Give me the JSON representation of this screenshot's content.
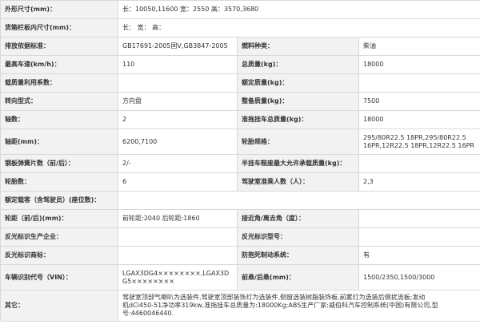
{
  "rows": [
    {
      "l1": "外形尺寸(mm)：",
      "v1": "长：10050,11600 宽：2550 高：3570,3680"
    },
    {
      "l1": "货箱栏板内尺寸(mm)：",
      "v1": "长： 宽： 高："
    },
    {
      "l1": "排放依据标准：",
      "v1": "GB17691-2005国Ⅴ,GB3847-2005",
      "l2": "燃料种类：",
      "v2": "柴油"
    },
    {
      "l1": "最高车速(km/h)：",
      "v1": "110",
      "l2": "总质量(kg)：",
      "v2": "18000"
    },
    {
      "l1": "载质量利用系数：",
      "v1": "",
      "l2": "额定质量(kg)：",
      "v2": ""
    },
    {
      "l1": "转向型式：",
      "v1": "方向盘",
      "l2": "整备质量(kg)：",
      "v2": "7500"
    },
    {
      "l1": "轴数：",
      "v1": "2",
      "l2": "准拖挂车总质量(kg)：",
      "v2": "18000"
    },
    {
      "l1": "轴距(mm)：",
      "v1": "6200,7100",
      "l2": "轮胎规格：",
      "v2a": "295/80R22.5 18PR,295/80R22.5",
      "v2b": "16PR,12R22.5 18PR,12R22.5 16PR"
    },
    {
      "l1": "钢板弹簧片数（前/后）：",
      "v1": "2/-",
      "l2": "半挂车鞍座最大允许承载质量(kg)：",
      "v2": ""
    },
    {
      "l1": "轮胎数：",
      "v1": "6",
      "l2": "驾驶室准乘人数（人）：",
      "v2": "2,3"
    },
    {
      "l1": "额定载客（含驾驶员）(座位数)：",
      "v1": ""
    },
    {
      "l1": "轮距（前/后)(mm)：",
      "v1": "前轮距:2040 后轮距:1860",
      "l2": "接近角/离去角（度）：",
      "v2": ""
    },
    {
      "l1": "反光标识生产企业：",
      "v1": "",
      "l2": "反光标识型号：",
      "v2": ""
    },
    {
      "l1": "反光标识商标：",
      "v1": "",
      "l2": "防抱死制动系统：",
      "v2": "有"
    },
    {
      "l1": "车辆识别代号（VIN）：",
      "v1a": "LGAX3DG4××××××××,LGAX3D",
      "v1b": "G5××××××××",
      "l2": "前悬/后悬(mm)：",
      "v2": "1500/2350,1500/3000"
    },
    {
      "l1": "其它：",
      "v1a": "驾驶室顶部气喇叭为选装件,驾驶室顶部装饰灯为选装件,侧窗选装树脂装饰板,前雾灯为选装后侧扰流板;发动",
      "v1b": "机dCi450-51净功率319kw,准拖挂车总质量为:18000Kg;ABS生产厂家:威伯科汽车控制系统(中国)有限公司,型",
      "v1c": "号:4460046440."
    }
  ]
}
